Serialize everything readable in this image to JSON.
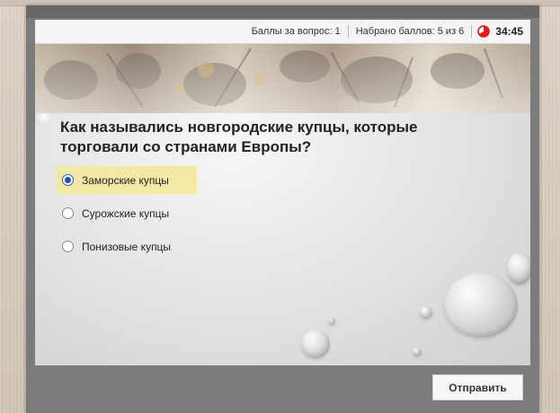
{
  "status": {
    "points_per_question": "Баллы за вопрос: 1",
    "score": "Набрано баллов: 5 из 6",
    "timer": "34:45"
  },
  "question": {
    "text": "Как назывались новгородские купцы, которые торговали со странами Европы?"
  },
  "options": [
    {
      "label": "Заморские купцы",
      "selected": true
    },
    {
      "label": "Сурожские купцы",
      "selected": false
    },
    {
      "label": "Понизовые купцы",
      "selected": false
    }
  ],
  "actions": {
    "submit_label": "Отправить"
  },
  "colors": {
    "selected_highlight": "#f2e9a6",
    "radio_selected": "#1f4fb0",
    "timer_icon": "#e02020"
  },
  "icons": {
    "timer": "stopwatch-icon"
  }
}
